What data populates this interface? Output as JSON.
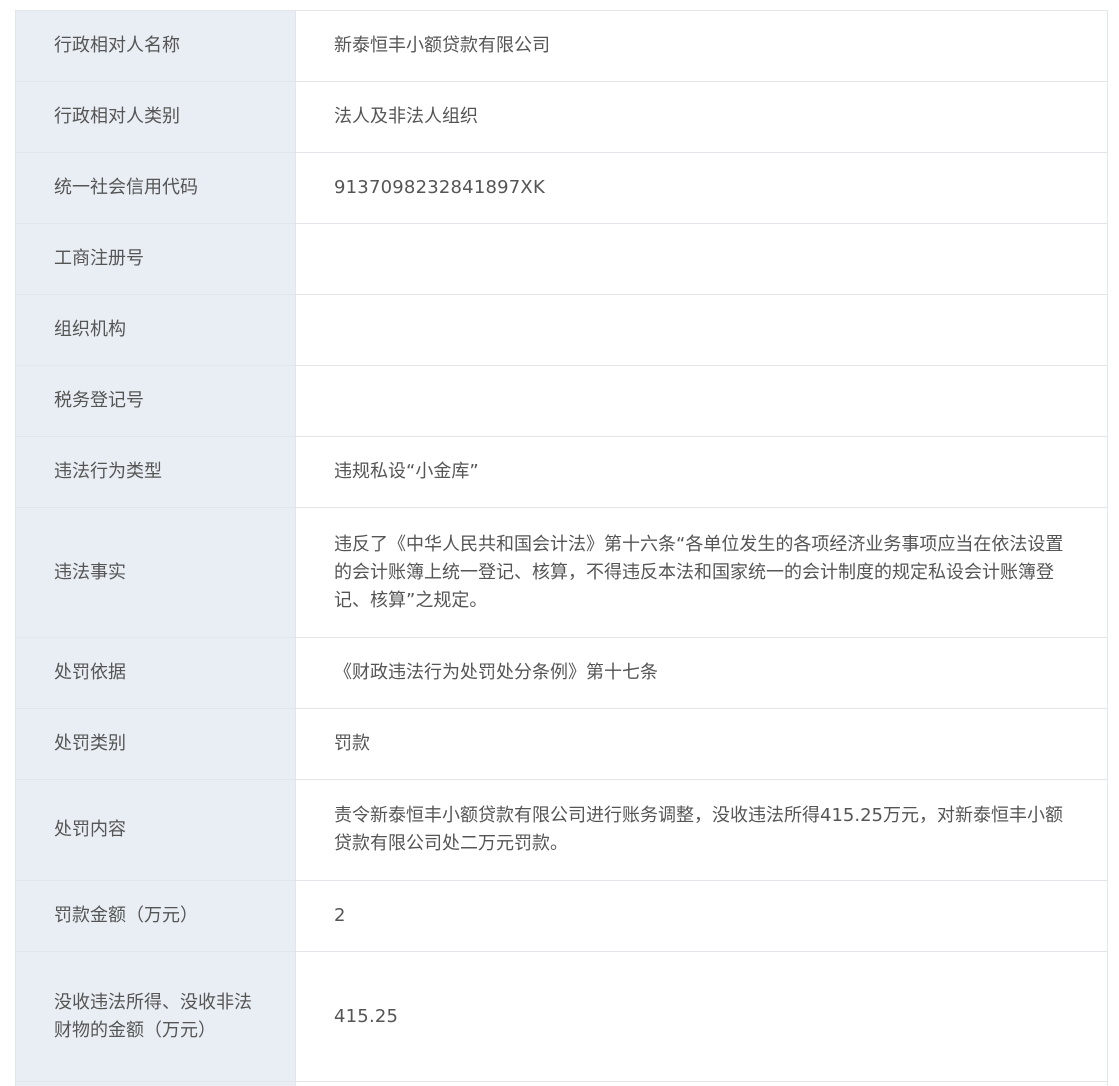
{
  "rows": [
    {
      "label": "行政相对人名称",
      "value": "新泰恒丰小额贷款有限公司"
    },
    {
      "label": "行政相对人类别",
      "value": "法人及非法人组织"
    },
    {
      "label": "统一社会信用代码",
      "value": "9137098232841897XK"
    },
    {
      "label": "工商注册号",
      "value": ""
    },
    {
      "label": "组织机构",
      "value": ""
    },
    {
      "label": "税务登记号",
      "value": ""
    },
    {
      "label": "违法行为类型",
      "value": "违规私设“小金库”"
    },
    {
      "label": "违法事实",
      "value": "违反了《中华人民共和国会计法》第十六条“各单位发生的各项经济业务事项应当在依法设置的会计账簿上统一登记、核算，不得违反本法和国家统一的会计制度的规定私设会计账簿登记、核算”之规定。"
    },
    {
      "label": "处罚依据",
      "value": "《财政违法行为处罚处分条例》第十七条"
    },
    {
      "label": "处罚类别",
      "value": "罚款"
    },
    {
      "label": "处罚内容",
      "value": "责令新泰恒丰小额贷款有限公司进行账务调整，没收违法所得415.25万元，对新泰恒丰小额贷款有限公司处二万元罚款。"
    },
    {
      "label": "罚款金额（万元）",
      "value": "2"
    },
    {
      "label": "没收违法所得、没收非法财物的金额（万元）",
      "value": "415.25"
    }
  ]
}
